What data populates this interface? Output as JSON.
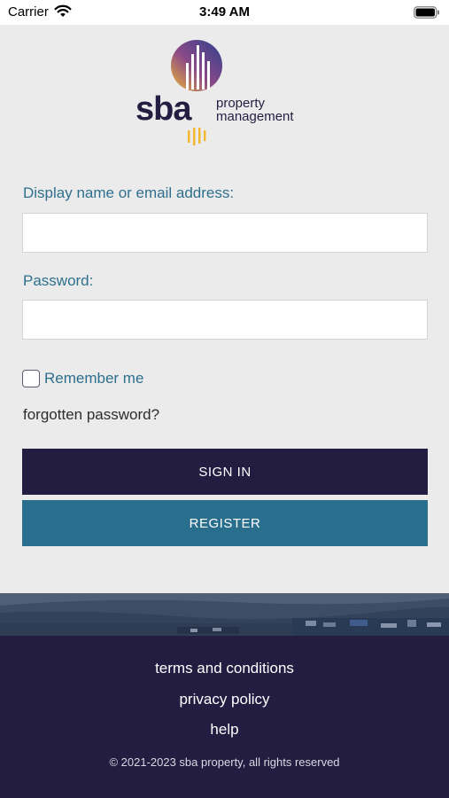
{
  "status_bar": {
    "carrier": "Carrier",
    "time": "3:49 AM"
  },
  "logo": {
    "brand": "sba",
    "line1": "property",
    "line2": "management"
  },
  "form": {
    "username_label": "Display name or email address:",
    "username_value": "",
    "password_label": "Password:",
    "password_value": "",
    "remember_label": "Remember me",
    "remember_checked": false,
    "forgot_label": "forgotten password?",
    "signin_label": "SIGN IN",
    "register_label": "REGISTER"
  },
  "footer": {
    "links": [
      "terms and conditions",
      "privacy policy",
      "help"
    ],
    "copyright": "© 2021-2023 sba property, all rights reserved"
  },
  "colors": {
    "primary_dark": "#241d42",
    "register_teal": "#2a6e8d",
    "label_blue": "#2e6f8e",
    "background": "#ebebeb"
  }
}
